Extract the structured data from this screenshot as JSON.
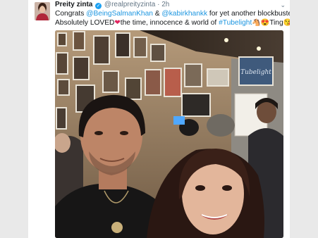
{
  "tweet": {
    "author_name": "Preity zinta",
    "verified_icon": "✓",
    "handle": "@realpreityzinta",
    "separator": "·",
    "time": "2h",
    "more_icon": "⌄",
    "line1": {
      "prefix": "Congrats ",
      "mention1": "@BeingSalmanKhan",
      "amp": " & ",
      "mention2": "@kabirkhankk",
      "suffix": " for yet another blockbuster",
      "emoji": "👏"
    },
    "line2": {
      "prefix": "Absolutely LOVED",
      "heart": "❤",
      "middle": "the time, innocence & world of ",
      "hashtag": "#Tubelight",
      "emoji_a": "🐴",
      "emoji_b": "😍",
      "suffix": "Ting",
      "emoji_c": "😘"
    }
  },
  "photo": {
    "poster_text": "Tubelight"
  },
  "colors": {
    "link": "#1b95e0",
    "verified": "#1da1f2",
    "heart": "#e0245e"
  }
}
